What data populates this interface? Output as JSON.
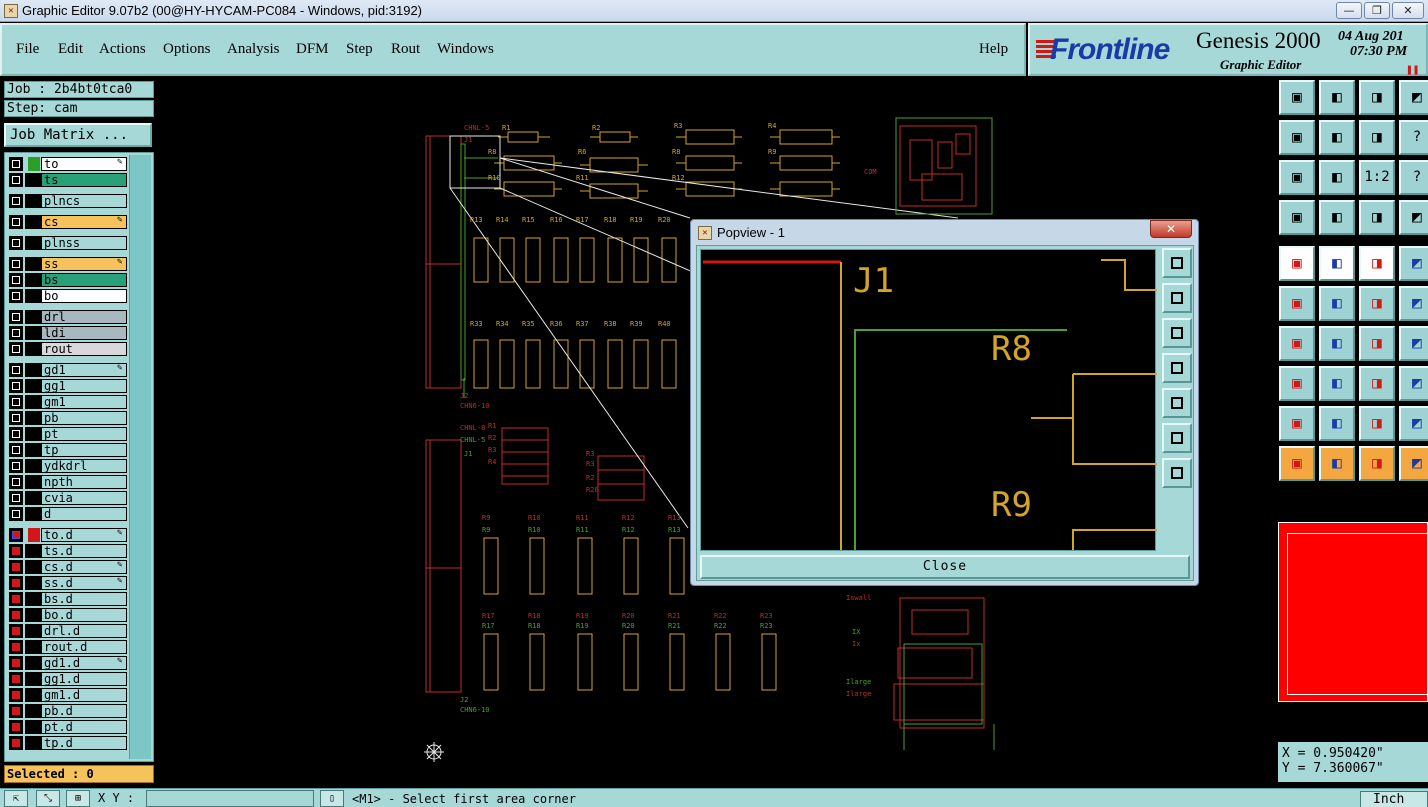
{
  "window": {
    "title": "Graphic Editor 9.07b2 (00@HY-HYCAM-PC084 - Windows, pid:3192)",
    "controls": [
      "—",
      "❐",
      "✕"
    ]
  },
  "menu": {
    "items": [
      "File",
      "Edit",
      "Actions",
      "Options",
      "Analysis",
      "DFM",
      "Step",
      "Rout",
      "Windows"
    ],
    "help": "Help"
  },
  "brand": {
    "logo": "Frontline",
    "product": "Genesis 2000",
    "subtitle": "Graphic Editor",
    "date": "04 Aug 201",
    "time": "07:30 PM",
    "pause": "❚❚"
  },
  "job": {
    "job_label": "Job : 2b4bt0tca0",
    "step_label": "Step: cam",
    "matrix_button": "Job Matrix ..."
  },
  "layers": [
    {
      "name": "to",
      "fill": "#ffffff",
      "swatch": "#2aa02a",
      "check": "box",
      "edit": true
    },
    {
      "name": "ts",
      "fill": "#2aa078",
      "swatch": "",
      "check": "box",
      "edit": false
    },
    {
      "name": "plncs",
      "fill": "#a6d8d8",
      "swatch": "",
      "check": "box",
      "edit": false
    },
    {
      "name": "cs",
      "fill": "#f6c25c",
      "swatch": "",
      "check": "box",
      "edit": true
    },
    {
      "name": "plnss",
      "fill": "#a6d8d8",
      "swatch": "",
      "check": "box",
      "edit": false
    },
    {
      "name": "ss",
      "fill": "#f6c25c",
      "swatch": "",
      "check": "box",
      "edit": true
    },
    {
      "name": "bs",
      "fill": "#2aa078",
      "swatch": "",
      "check": "box",
      "edit": false
    },
    {
      "name": "bo",
      "fill": "#ffffff",
      "swatch": "",
      "check": "box",
      "edit": false
    },
    {
      "name": "drl",
      "fill": "#a8b8c0",
      "swatch": "",
      "check": "box",
      "edit": false
    },
    {
      "name": "ldi",
      "fill": "#a8b8c0",
      "swatch": "",
      "check": "box",
      "edit": false
    },
    {
      "name": "rout",
      "fill": "#d8d8d8",
      "swatch": "",
      "check": "box",
      "edit": false
    },
    {
      "name": "gd1",
      "fill": "#a6d8d8",
      "swatch": "",
      "check": "box",
      "edit": true
    },
    {
      "name": "gg1",
      "fill": "#a6d8d8",
      "swatch": "",
      "check": "box",
      "edit": false
    },
    {
      "name": "gm1",
      "fill": "#a6d8d8",
      "swatch": "",
      "check": "box",
      "edit": false
    },
    {
      "name": "pb",
      "fill": "#a6d8d8",
      "swatch": "",
      "check": "box",
      "edit": false
    },
    {
      "name": "pt",
      "fill": "#a6d8d8",
      "swatch": "",
      "check": "box",
      "edit": false
    },
    {
      "name": "tp",
      "fill": "#a6d8d8",
      "swatch": "",
      "check": "box",
      "edit": false
    },
    {
      "name": "ydkdrl",
      "fill": "#a6d8d8",
      "swatch": "",
      "check": "box",
      "edit": false
    },
    {
      "name": "npth",
      "fill": "#a6d8d8",
      "swatch": "",
      "check": "box",
      "edit": false
    },
    {
      "name": "cvia",
      "fill": "#a6d8d8",
      "swatch": "",
      "check": "box",
      "edit": false
    },
    {
      "name": "d",
      "fill": "#a6d8d8",
      "swatch": "",
      "check": "box",
      "edit": false
    },
    {
      "name": "to.d",
      "fill": "#a6d8d8",
      "swatch": "#d01818",
      "check": "redx",
      "edit": true
    },
    {
      "name": "ts.d",
      "fill": "#a6d8d8",
      "swatch": "",
      "check": "red",
      "edit": false
    },
    {
      "name": "cs.d",
      "fill": "#a6d8d8",
      "swatch": "",
      "check": "red",
      "edit": true
    },
    {
      "name": "ss.d",
      "fill": "#a6d8d8",
      "swatch": "",
      "check": "red",
      "edit": true
    },
    {
      "name": "bs.d",
      "fill": "#a6d8d8",
      "swatch": "",
      "check": "red",
      "edit": false
    },
    {
      "name": "bo.d",
      "fill": "#a6d8d8",
      "swatch": "",
      "check": "red",
      "edit": false
    },
    {
      "name": "drl.d",
      "fill": "#a6d8d8",
      "swatch": "",
      "check": "red",
      "edit": false
    },
    {
      "name": "rout.d",
      "fill": "#a6d8d8",
      "swatch": "",
      "check": "red",
      "edit": false
    },
    {
      "name": "gd1.d",
      "fill": "#a6d8d8",
      "swatch": "",
      "check": "red",
      "edit": true
    },
    {
      "name": "gg1.d",
      "fill": "#a6d8d8",
      "swatch": "",
      "check": "red",
      "edit": false
    },
    {
      "name": "gm1.d",
      "fill": "#a6d8d8",
      "swatch": "",
      "check": "red",
      "edit": false
    },
    {
      "name": "pb.d",
      "fill": "#a6d8d8",
      "swatch": "",
      "check": "red",
      "edit": false
    },
    {
      "name": "pt.d",
      "fill": "#a6d8d8",
      "swatch": "",
      "check": "red",
      "edit": false
    },
    {
      "name": "tp.d",
      "fill": "#a6d8d8",
      "swatch": "",
      "check": "red",
      "edit": false
    }
  ],
  "selected": "Selected : 0",
  "bottombar": {
    "xy_label": "X Y :",
    "xy_value": "",
    "status": "<M1> - Select first area corner",
    "units": "Inch"
  },
  "coords": {
    "x": "X = 0.950420\"",
    "y": "Y = 7.360067\""
  },
  "popview": {
    "title": "Popview - 1",
    "close_label": "Close",
    "labels": [
      "J1",
      "R8",
      "R9"
    ]
  },
  "board": {
    "top_refs": [
      "R1",
      "R2",
      "R3",
      "R4",
      "R8",
      "R6",
      "R8",
      "R9",
      "R10",
      "R11",
      "R12"
    ],
    "connectors": [
      "CHNL-5",
      "J1",
      "J2",
      "CHN6-10",
      "CHNL-8",
      "CHNL-5",
      "J1",
      "J2",
      "CHN6-10",
      "COM"
    ],
    "row1": [
      "R13",
      "R14",
      "R15",
      "R16",
      "R17",
      "R18",
      "R19",
      "R20"
    ],
    "row2": [
      "R33",
      "R34",
      "R35",
      "R36",
      "R37",
      "R38",
      "R39",
      "R40"
    ],
    "lower_refs": [
      "R1",
      "R2",
      "R3",
      "R4",
      "R3",
      "R3",
      "R2",
      "R26"
    ],
    "lower_row1": [
      "R9",
      "R10",
      "R11",
      "R12",
      "R13"
    ],
    "lower_row2": [
      "R17",
      "R18",
      "R19",
      "R20",
      "R21",
      "R22",
      "R23"
    ],
    "misc": [
      "Iswall",
      "IX",
      "Ix",
      "Ilarge",
      "Ilarge"
    ],
    "colors": {
      "silk": "#d4a426",
      "outline": "#c42a2a",
      "green": "#4aa02a",
      "white": "#e8e8e8"
    }
  },
  "toolbox": {
    "row_icons": [
      [
        "zoom-home-icon",
        "zoom-in-icon",
        "house-icon",
        "window-icon"
      ],
      [
        "pan-left-icon",
        "pan-right-icon",
        "swap-icon",
        "help-icon"
      ],
      [
        "fit-icon",
        "center-icon",
        "ratio-icon",
        "query-icon"
      ],
      [
        "snap-icon",
        "probe-icon",
        "layer-red-icon",
        "layer-red2-icon"
      ],
      [
        "pad-icon",
        "line-red-icon",
        "ruler-icon",
        "dot-icon"
      ],
      [
        "net-icon",
        "cross-icon",
        "diag-icon",
        "diag2-icon"
      ],
      [
        "angle-icon",
        "slope-icon",
        "arc-icon",
        "text-icon"
      ],
      [
        "marker-icon",
        "segment-icon",
        "grid-icon",
        "shape-icon"
      ],
      [
        "triangle-icon",
        "triangle2-icon",
        "triangle3-icon",
        "triangle4-icon"
      ],
      [
        "select-icon",
        "select-box-icon",
        "select-circle-icon",
        "select-poly-icon"
      ]
    ],
    "ratio_text": "1:2",
    "query_text": "?"
  }
}
